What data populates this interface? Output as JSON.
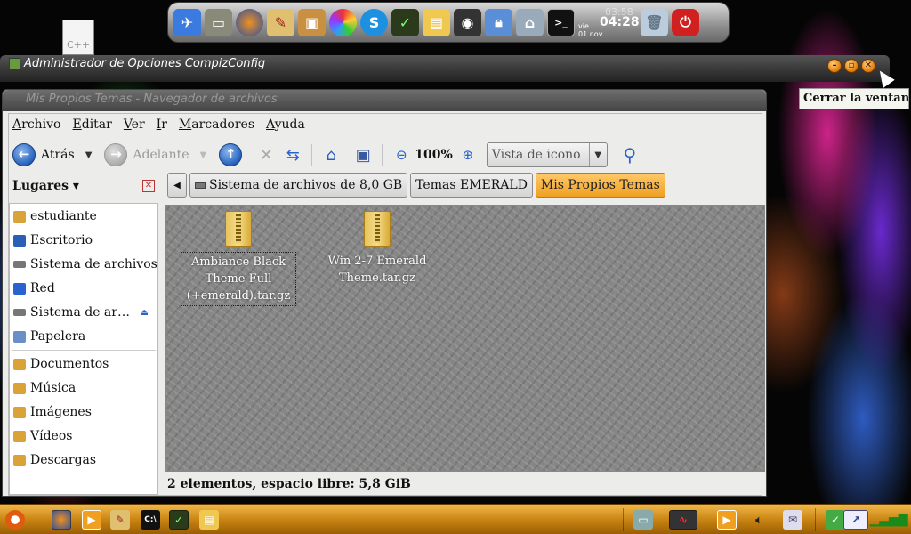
{
  "dock": {
    "icons": [
      "python-icon",
      "folder-icon",
      "firefox-icon",
      "paint-icon",
      "package-icon",
      "color-wheel-icon",
      "skype-icon",
      "system-monitor-icon",
      "file-manager-icon",
      "speaker-icon",
      "lock-icon",
      "network-icon",
      "terminal-icon",
      "trash-icon",
      "power-icon"
    ],
    "clock": {
      "day": "vie",
      "date": "01 nov",
      "ghost_time": "03:58",
      "time": "04:28"
    }
  },
  "desktop": {
    "file_label": "C++"
  },
  "ccsm": {
    "title": "Administrador de Opciones CompizConfig",
    "tooltip": "Cerrar la ventana"
  },
  "nautilus": {
    "title": "Mis Propios Temas - Navegador de archivos",
    "menu": [
      "Archivo",
      "Editar",
      "Ver",
      "Ir",
      "Marcadores",
      "Ayuda"
    ],
    "toolbar": {
      "back": "Atrás",
      "forward": "Adelante",
      "zoom": "100%",
      "view_mode": "Vista de icono"
    },
    "sidebar": {
      "header": "Lugares",
      "items": [
        {
          "label": "estudiante",
          "icon": "home-icon",
          "color": "#d9a33a"
        },
        {
          "label": "Escritorio",
          "icon": "desktop-icon",
          "color": "#2a5fb8"
        },
        {
          "label": "Sistema de archivos",
          "icon": "drive-icon",
          "color": "#777777"
        },
        {
          "label": "Red",
          "icon": "network-icon",
          "color": "#2a62d0"
        },
        {
          "label": "Sistema de ar…",
          "icon": "drive-icon",
          "color": "#777777"
        },
        {
          "label": "Papelera",
          "icon": "trash-icon",
          "color": "#6a8fc8"
        },
        {
          "label": "Documentos",
          "icon": "folder-icon",
          "color": "#d9a33a"
        },
        {
          "label": "Música",
          "icon": "folder-icon",
          "color": "#d9a33a"
        },
        {
          "label": "Imágenes",
          "icon": "folder-icon",
          "color": "#d9a33a"
        },
        {
          "label": "Vídeos",
          "icon": "folder-icon",
          "color": "#d9a33a"
        },
        {
          "label": "Descargas",
          "icon": "folder-icon",
          "color": "#d9a33a"
        }
      ]
    },
    "breadcrumbs": [
      "Sistema de archivos de 8,0 GB",
      "Temas EMERALD",
      "Mis Propios Temas"
    ],
    "files": [
      {
        "name": "Ambiance Black Theme Full (+emerald).tar.gz",
        "selected": true
      },
      {
        "name": "Win 2-7 Emerald Theme.tar.gz",
        "selected": false
      }
    ],
    "status": "2 elementos, espacio libre: 5,8 GiB"
  },
  "panel": {
    "icons": [
      "ubuntu-logo-icon",
      "firefox-icon",
      "media-player-icon",
      "paint-icon",
      "terminal-icon",
      "system-monitor-icon",
      "file-manager-icon",
      "window-icon",
      "graph-icon",
      "video-icon",
      "volume-icon",
      "notes-icon",
      "checkbox-icon",
      "screen-icon",
      "signal-icon"
    ]
  },
  "colors": {
    "accent": "#f0a020",
    "panel": "#c68110"
  }
}
